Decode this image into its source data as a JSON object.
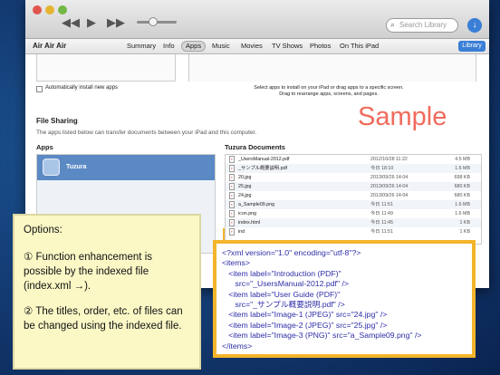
{
  "window": {
    "search_placeholder": "Search Library",
    "device_label": "Air Air Air",
    "library_button": "Library"
  },
  "tabs": [
    "Summary",
    "Info",
    "Apps",
    "Music",
    "Movies",
    "TV Shows",
    "Photos",
    "On This iPad"
  ],
  "active_tab": "Apps",
  "sync": {
    "auto_install_label": "Automatically install new apps",
    "instruction_line1": "Select apps to install on your iPad or drag apps to a specific screen.",
    "instruction_line2": "Drag to rearrange apps, screens, and pages."
  },
  "file_sharing": {
    "title": "File Sharing",
    "description": "The apps listed below can transfer documents between your iPad and this computer.",
    "apps_header": "Apps",
    "docs_header": "Tuzura Documents",
    "app_name": "Tuzura",
    "documents": [
      {
        "name": "_UsersManual-2012.pdf",
        "date": "2012/10/28 11:22",
        "size": "4.5 MB"
      },
      {
        "name": "_サンプル概要説明.pdf",
        "date": "今日 18:10",
        "size": "1.6 MB"
      },
      {
        "name": "20.jpg",
        "date": "2013/09/26 14:04",
        "size": "698 KB"
      },
      {
        "name": "25.jpg",
        "date": "2013/09/26 14:04",
        "size": "680 KB"
      },
      {
        "name": "24.jpg",
        "date": "2013/09/26 14:04",
        "size": "680 KB"
      },
      {
        "name": "a_Sample09.png",
        "date": "今日 11:51",
        "size": "1.6 MB"
      },
      {
        "name": "icon.png",
        "date": "今日 11:49",
        "size": "1.6 MB"
      },
      {
        "name": "index.html",
        "date": "今日 11:45",
        "size": "1 KB"
      },
      {
        "name": "ind",
        "date": "今日 11:51",
        "size": "1 KB"
      }
    ]
  },
  "sample_label": "Sample",
  "options": {
    "heading": "Options:",
    "point1": "① Function enhancement is possible by the indexed file (index.xml →).",
    "point2": "② The titles, order, etc. of files can be changed using the indexed file."
  },
  "xml": {
    "lines": [
      "<?xml version=\"1.0\" encoding=\"utf-8\"?>",
      "<items>",
      "   <item label=\"Introduction (PDF)\"",
      "      src=\"_UsersManual-2012.pdf\" />",
      "   <item label=\"User Guide (PDF)\"",
      "      src=\"_サンプル概要説明.pdf\" />",
      "   <item label=\"Image-1 (JPEG)\" src=\"24.jpg\" />",
      "   <item label=\"Image-2 (JPEG)\" src=\"25.jpg\" />",
      "   <item label=\"Image-3 (PNG)\" src=\"a_Sample09.png\" />",
      "</items>"
    ]
  },
  "colors": {
    "sample_text": "#f06b5b",
    "callout_border": "#f3b52b",
    "notes_background": "#fbf8c6",
    "selection_blue": "#5b89c4"
  },
  "icons": {
    "window_controls": [
      "close-icon",
      "minimize-icon",
      "zoom-icon"
    ],
    "playback": [
      "rewind-icon",
      "play-icon",
      "fast-forward-icon"
    ],
    "other": [
      "apple-logo-icon",
      "search-icon",
      "download-icon",
      "app-icon",
      "document-icon"
    ]
  }
}
